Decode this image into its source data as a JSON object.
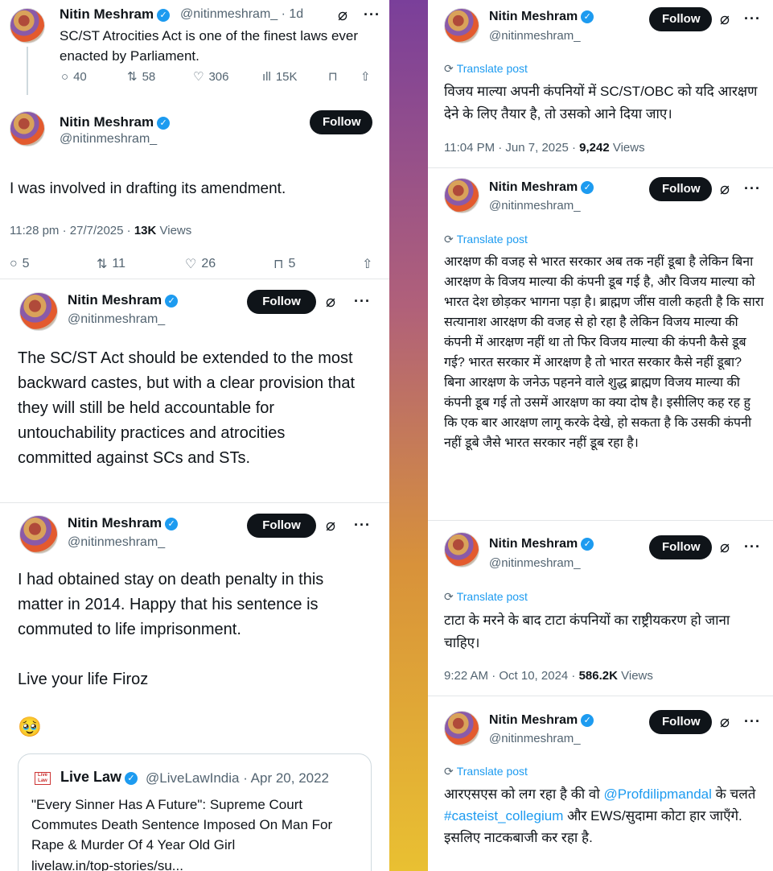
{
  "left": {
    "t1": {
      "name": "Nitin Meshram",
      "handle_line": "@nitinmeshram_ · 1d",
      "text": "SC/ST Atrocities Act is one of the finest laws ever enacted by Parliament.",
      "replies": "40",
      "reposts": "58",
      "likes": "306",
      "views": "15K"
    },
    "t2": {
      "name": "Nitin Meshram",
      "handle": "@nitinmeshram_",
      "follow": "Follow",
      "text": "I was involved in drafting its amendment.",
      "time": "11:28 pm · 27/7/2025 · ",
      "views_count": "13K",
      "views_label": " Views",
      "replies": "5",
      "reposts": "11",
      "likes": "26",
      "bookmarks": "5"
    },
    "t3": {
      "name": "Nitin Meshram",
      "handle": "@nitinmeshram_",
      "follow": "Follow",
      "text": "The SC/ST Act should be extended to the most backward castes, but with a clear provision that they will still be held accountable for untouchability practices and atrocities committed against SCs and STs."
    },
    "t4": {
      "name": "Nitin Meshram",
      "handle": "@nitinmeshram_",
      "follow": "Follow",
      "text1": "I had obtained stay on death penalty in this matter in 2014. Happy that his sentence is commuted to life imprisonment.",
      "text2": "Live your life Firoz",
      "emoji": "🥹",
      "quote": {
        "logo": "Live Law",
        "name": "Live Law",
        "handle_line": "@LiveLawIndia · Apr 20, 2022",
        "text": "\"Every Sinner Has A Future\": Supreme Court Commutes Death Sentence Imposed On Man For Rape & Murder Of 4 Year Old Girl",
        "url": "livelaw.in/top-stories/su..."
      }
    }
  },
  "right": {
    "r1": {
      "name": "Nitin Meshram",
      "handle": "@nitinmeshram_",
      "follow": "Follow",
      "translate": "Translate post",
      "text": "विजय माल्या अपनी कंपनियों में SC/ST/OBC को यदि आरक्षण देने के लिए तैयार है, तो उसको आने दिया जाए।",
      "time": "11:04 PM · Jun 7, 2025 · ",
      "views_count": "9,242",
      "views_label": " Views"
    },
    "r2": {
      "name": "Nitin Meshram",
      "handle": "@nitinmeshram_",
      "follow": "Follow",
      "translate": "Translate post",
      "text": "आरक्षण की वजह से भारत सरकार अब तक नहीं डूबा है लेकिन बिना आरक्षण के विजय माल्या की कंपनी डूब गई है, और विजय माल्या को भारत देश छोड़कर भागना पड़ा है। ब्राह्मण जींस वाली कहती है कि सारा सत्यानाश आरक्षण की वजह से हो रहा है लेकिन विजय माल्या की कंपनी में आरक्षण नहीं था तो फिर विजय माल्या की कंपनी कैसे डूब गई? भारत सरकार में आरक्षण है तो भारत सरकार कैसे नहीं डूबा? बिना आरक्षण के जनेऊ पहनने वाले शुद्ध ब्राह्मण विजय माल्या की कंपनी डूब गई तो उसमें आरक्षण का क्या दोष है। इसीलिए कह रह हु कि एक बार आरक्षण लागू करके देखे, हो सकता है कि उसकी कंपनी नहीं डूबे जैसे भारत सरकार नहीं डूब रहा है।"
    },
    "r3": {
      "name": "Nitin Meshram",
      "handle": "@nitinmeshram_",
      "follow": "Follow",
      "translate": "Translate post",
      "text": "टाटा के मरने के बाद टाटा कंपनियों का राष्ट्रीयकरण हो जाना चाहिए।",
      "time": "9:22 AM · Oct 10, 2024 · ",
      "views_count": "586.2K",
      "views_label": " Views"
    },
    "r4": {
      "name": "Nitin Meshram",
      "handle": "@nitinmeshram_",
      "follow": "Follow",
      "translate": "Translate post",
      "text_a": "आरएसएस को लग रहा है की वो ",
      "mention": "@Profdilipmandal",
      "text_b": " के चलते ",
      "hashtag": "#casteist_collegium",
      "text_c": " और EWS/सुदामा कोटा हार जाएँगे. इसलिए नाटकबाजी कर रहा है."
    }
  },
  "icons": {
    "verified": "✓",
    "grok": "⌀",
    "more": "···",
    "reply": "○",
    "repost": "⇅",
    "like": "♡",
    "views": "ıll",
    "bookmark": "⊓",
    "share": "⇧",
    "translate": "⟳"
  },
  "colors": {
    "accent": "#1d9bf0",
    "text": "#0f1419",
    "muted": "#536471"
  }
}
